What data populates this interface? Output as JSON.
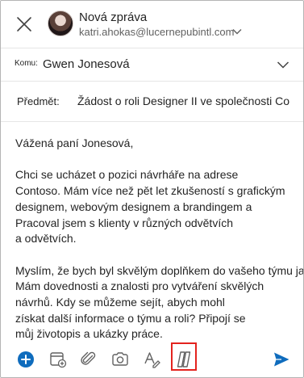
{
  "header": {
    "title": "Nová zpráva",
    "account": "katri.ahokas@lucernepubintl.com"
  },
  "recipient": {
    "label": "Komu:",
    "value": "Gwen Jonesová"
  },
  "subject": {
    "label": "Předmět:",
    "value": "Žádost o roli Designer II ve společnosti Co"
  },
  "body": {
    "greeting": "Vážená paní Jonesová,",
    "paragraph1": [
      "Chci se ucházet o pozici návrháře na adrese",
      "Contoso. Mám více než pět let zkušeností s grafickým",
      "designem, webovým designem a brandingem a",
      "Pracoval jsem s klienty v různých odvětvích",
      "a odvětvích."
    ],
    "paragraph2": [
      "Myslím, že bych byl skvělým doplňkem do vašeho týmu jako",
      "Mám dovednosti a znalosti pro vytváření skvělých",
      "návrhů. Kdy se můžeme sejít, abych mohl",
      "získat další informace o týmu a roli? Připojí se",
      "můj životopis a ukázky práce."
    ]
  },
  "toolbar": {
    "icons": [
      "add-icon",
      "calendar-add-icon",
      "attach-icon",
      "camera-icon",
      "text-format-icon",
      "copilot-icon",
      "send-icon"
    ]
  },
  "colors": {
    "accent": "#0f6cbd",
    "highlight": "#e3231e"
  }
}
